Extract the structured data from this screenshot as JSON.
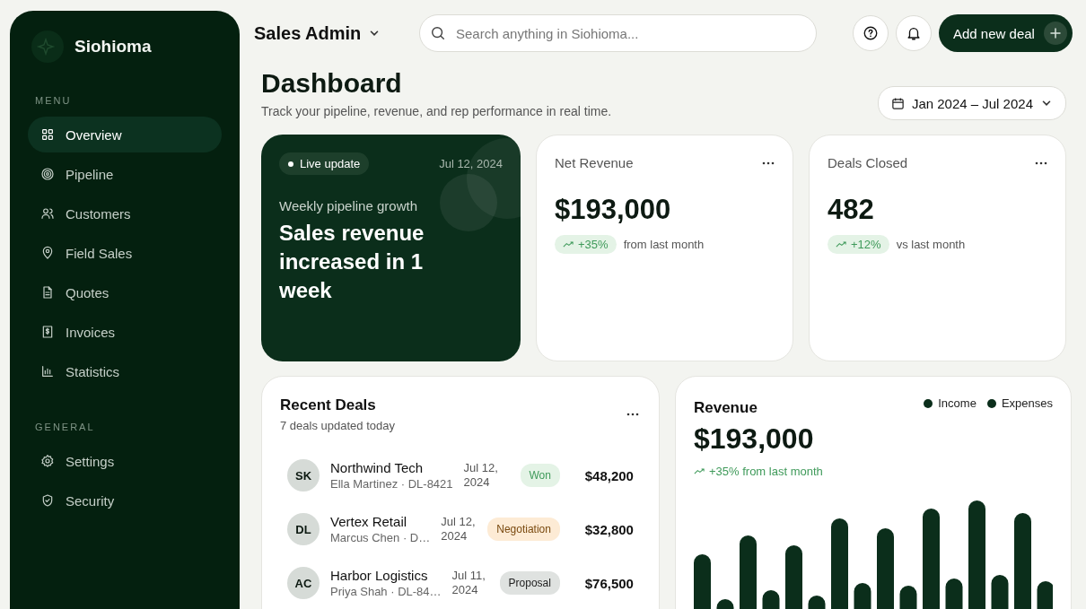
{
  "sidebar": {
    "brand": "Siohioma",
    "sections": [
      {
        "heading": "MENU",
        "items": [
          {
            "label": "Overview",
            "selected": true
          },
          {
            "label": "Pipeline",
            "selected": false
          },
          {
            "label": "Customers",
            "selected": false
          },
          {
            "label": "Field Sales",
            "selected": false
          },
          {
            "label": "Quotes",
            "selected": false
          },
          {
            "label": "Invoices",
            "selected": false
          },
          {
            "label": "Statistics",
            "selected": false
          }
        ]
      },
      {
        "heading": "GENERAL",
        "items": [
          {
            "label": "Settings",
            "selected": false
          },
          {
            "label": "Security",
            "selected": false
          }
        ]
      }
    ]
  },
  "topbar": {
    "workspace": "Sales Admin",
    "search": {
      "placeholder": "Search anything in Siohioma..."
    },
    "action": "Add new deal"
  },
  "header": {
    "title": "Dashboard",
    "subtitle": "Track your pipeline, revenue, and rep performance in real time.",
    "date_range": "Jan 2024 – Jul 2024"
  },
  "hero": {
    "badge": "Live update",
    "date": "Jul 12, 2024",
    "kicker": "Weekly pipeline growth",
    "headline": "Sales revenue increased in 1 week"
  },
  "stats": [
    {
      "label": "Net Revenue",
      "value": "$193,000",
      "change": "+35%",
      "note": "from last month"
    },
    {
      "label": "Deals Closed",
      "value": "482",
      "change": "+12%",
      "note": "vs last month"
    }
  ],
  "recent_deals": {
    "title": "Recent Deals",
    "subtitle": "7 deals updated today",
    "rows": [
      {
        "initials": "SK",
        "company": "Northwind Tech",
        "detail": "Ella Martinez · DL-8421",
        "date": "Jul 12, 2024",
        "status": "Won",
        "kind": "won",
        "amount": "$48,200"
      },
      {
        "initials": "DL",
        "company": "Vertex Retail",
        "detail": "Marcus Chen · D…",
        "date": "Jul 12, 2024",
        "status": "Negotiation",
        "kind": "negotiation",
        "amount": "$32,800"
      },
      {
        "initials": "AC",
        "company": "Harbor Logistics",
        "detail": "Priya Shah · DL-84…",
        "date": "Jul 11, 2024",
        "status": "Proposal",
        "kind": "proposal",
        "amount": "$76,500"
      }
    ]
  },
  "revenue": {
    "title": "Revenue",
    "value": "$193,000",
    "change": "+35% from last month",
    "legend": [
      "Income",
      "Expenses"
    ]
  }
}
